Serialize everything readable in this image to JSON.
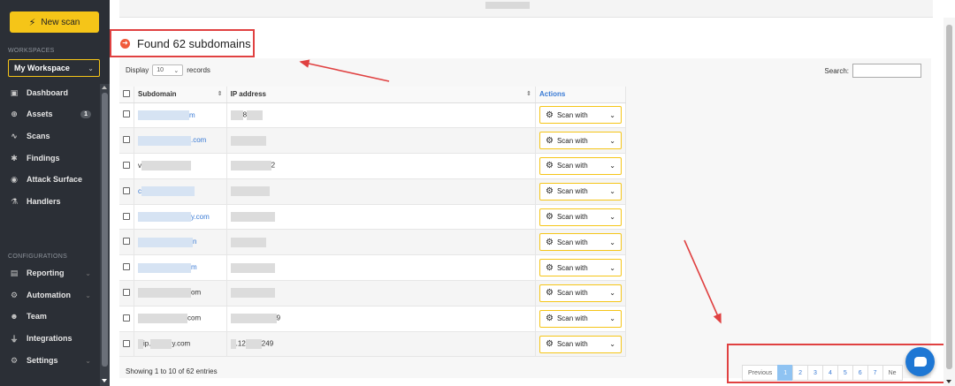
{
  "sidebar": {
    "new_scan_label": "New scan",
    "workspaces_title": "WORKSPACES",
    "workspace_selected": "My Workspace",
    "nav": [
      {
        "label": "Dashboard",
        "icon": "dashboard-icon"
      },
      {
        "label": "Assets",
        "icon": "assets-icon",
        "badge": "1"
      },
      {
        "label": "Scans",
        "icon": "scans-icon"
      },
      {
        "label": "Findings",
        "icon": "findings-icon"
      },
      {
        "label": "Attack Surface",
        "icon": "attack-surface-icon"
      },
      {
        "label": "Handlers",
        "icon": "handlers-icon"
      }
    ],
    "configurations_title": "CONFIGURATIONS",
    "config": [
      {
        "label": "Reporting",
        "icon": "reporting-icon"
      },
      {
        "label": "Automation",
        "icon": "automation-icon"
      },
      {
        "label": "Team",
        "icon": "team-icon"
      },
      {
        "label": "Integrations",
        "icon": "integrations-icon"
      },
      {
        "label": "Settings",
        "icon": "settings-icon"
      }
    ]
  },
  "main": {
    "found_title": "Found 62 subdomains",
    "display_label": "Display",
    "display_value": "10",
    "records_label": "records",
    "search_label": "Search:",
    "search_value": "",
    "columns": {
      "subdomain": "Subdomain",
      "ip": "IP address",
      "actions": "Actions"
    },
    "rows": [
      {
        "sub": "m",
        "ip": "8"
      },
      {
        "sub": ".com",
        "ip": ""
      },
      {
        "sub": "v",
        "ip": "2"
      },
      {
        "sub": "c",
        "ip": ""
      },
      {
        "sub": "y.com",
        "ip": ""
      },
      {
        "sub": "n",
        "ip": ""
      },
      {
        "sub": "m",
        "ip": ""
      },
      {
        "sub": "om",
        "ip": ""
      },
      {
        "sub": "com",
        "ip": "9"
      },
      {
        "sub": "ip.",
        "sub2": "y.com",
        "ip": ".12",
        "ip2": "249"
      }
    ],
    "scan_with_label": "Scan with",
    "showing_text": "Showing 1 to 10 of 62 entries",
    "pagination": {
      "previous": "Previous",
      "pages": [
        "1",
        "2",
        "3",
        "4",
        "5",
        "6",
        "7"
      ],
      "next": "Ne",
      "current": "1"
    }
  },
  "colors": {
    "accent": "#f5c518",
    "link": "#3a7bd5",
    "annotation": "#e04141",
    "chat": "#1e77d4"
  }
}
